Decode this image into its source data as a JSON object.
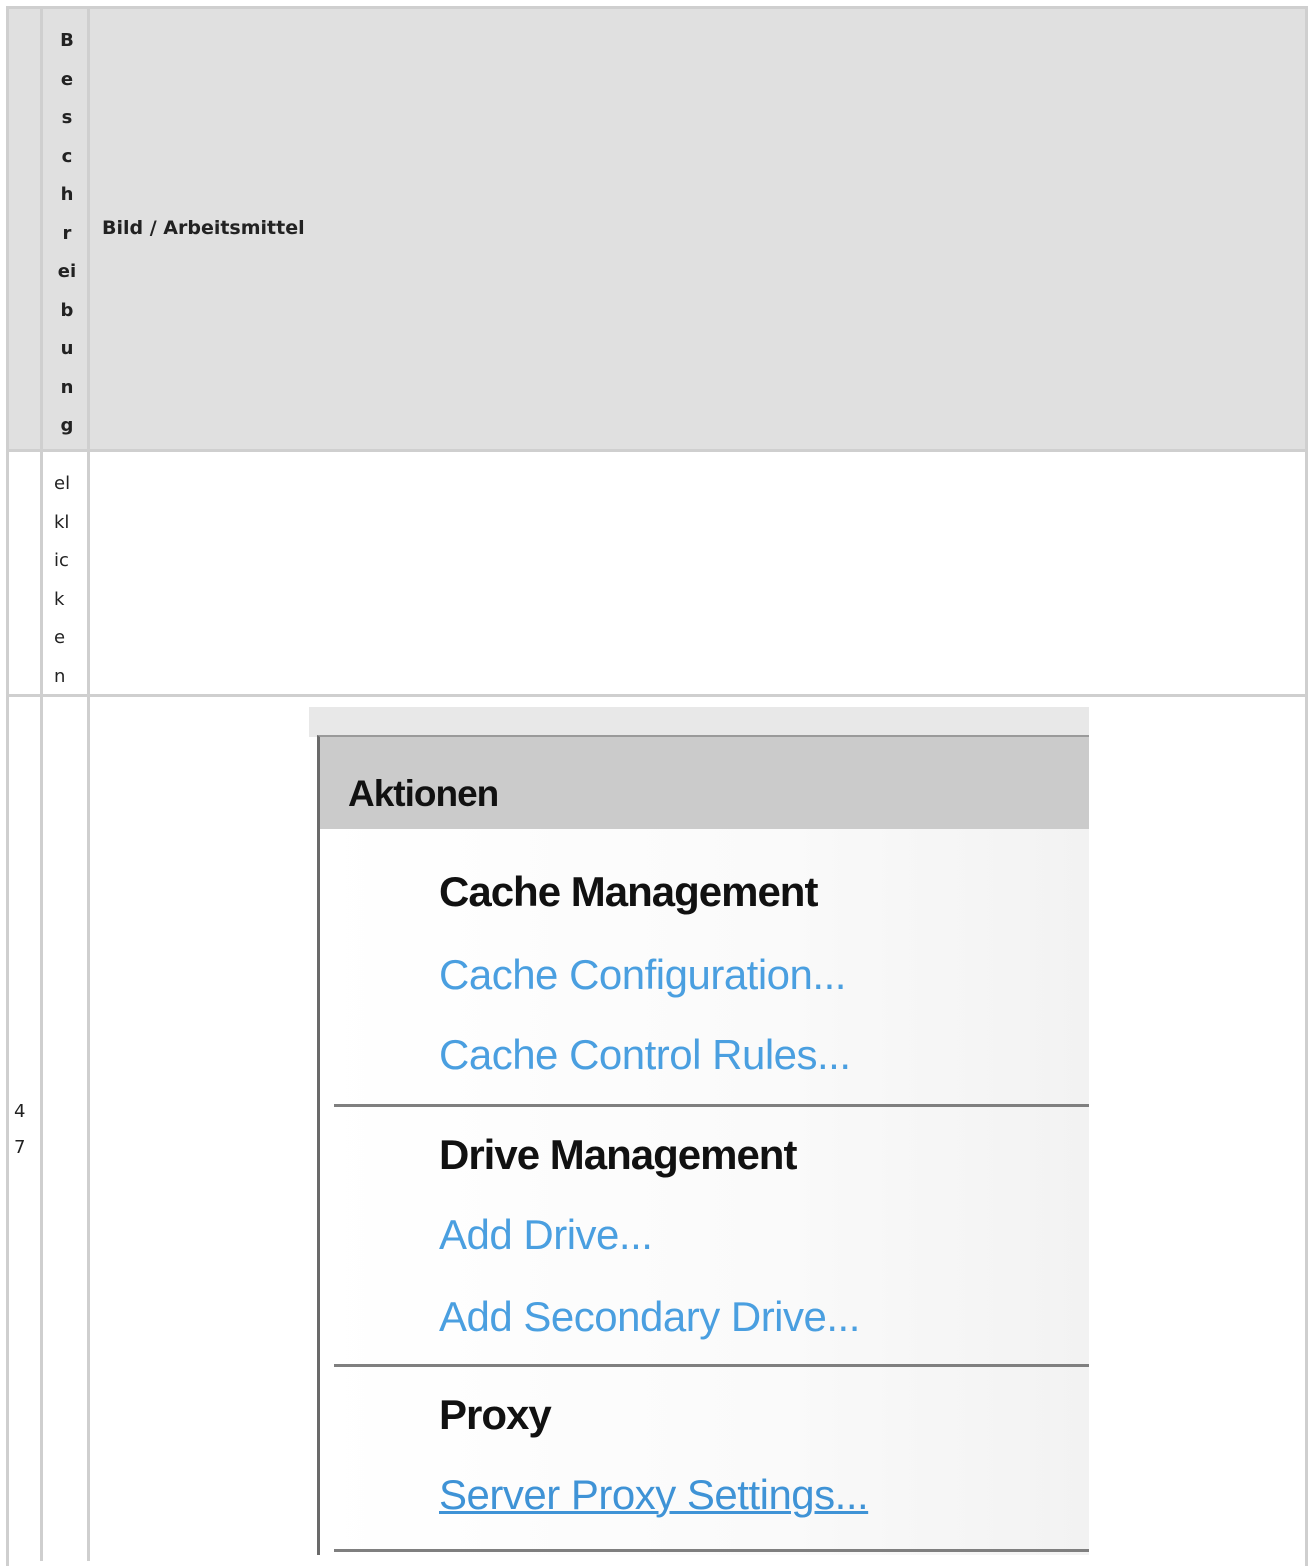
{
  "header": {
    "col_description_letters": [
      "B",
      "e",
      "s",
      "c",
      "h",
      "r",
      "ei",
      "b",
      "u",
      "n",
      "g"
    ],
    "col_image_title": "Bild / Arbeitsmittel"
  },
  "rows": [
    {
      "number": "",
      "description_letters": [
        "el",
        "kl",
        "ic",
        "k",
        "e",
        "n"
      ]
    },
    {
      "number_letters": [
        "4",
        "7"
      ]
    }
  ],
  "screenshot": {
    "panel_title": "Aktionen",
    "sections": [
      {
        "title": "Cache Management",
        "links": [
          "Cache Configuration...",
          "Cache Control Rules..."
        ]
      },
      {
        "title": "Drive Management",
        "links": [
          "Add Drive...",
          "Add Secondary Drive..."
        ]
      },
      {
        "title": "Proxy",
        "links": [
          "Server Proxy Settings..."
        ]
      }
    ],
    "colors": {
      "link": "#4a9fe0",
      "header_bg": "#cbcbcb"
    }
  }
}
